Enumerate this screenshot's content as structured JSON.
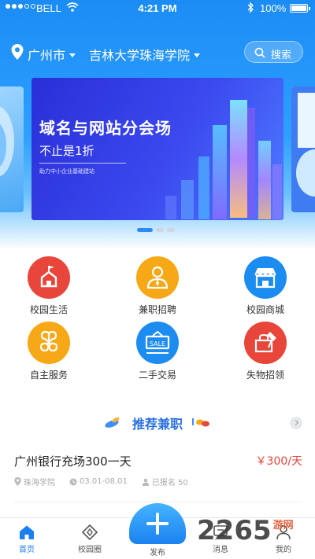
{
  "status_bar": {
    "carrier": "BELL",
    "time": "4:21 PM",
    "battery": "100%"
  },
  "header": {
    "city": "广州市",
    "school": "吉林大学珠海学院",
    "search_label": "搜索"
  },
  "banner": {
    "title": "域名与网站分会场",
    "subtitle": "不止是1折",
    "small_text": "助力中小企业基础建站",
    "page_count": 3,
    "active_page": 1
  },
  "services": [
    {
      "label": "校园生活",
      "icon": "flag-icon",
      "color": "#e8463a"
    },
    {
      "label": "兼职招聘",
      "icon": "recruiter-icon",
      "color": "#f6a817"
    },
    {
      "label": "校园商城",
      "icon": "shop-icon",
      "color": "#1c8cf0"
    },
    {
      "label": "自主服务",
      "icon": "clover-icon",
      "color": "#f6a817"
    },
    {
      "label": "二手交易",
      "icon": "trade-sign-icon",
      "color": "#1c8cf0"
    },
    {
      "label": "失物招领",
      "icon": "lost-found-icon",
      "color": "#e8463a"
    }
  ],
  "recommend": {
    "title": "推荐兼职",
    "jobs": [
      {
        "title": "广州银行充场300一天",
        "pay": "￥300/天",
        "location": "珠海学院",
        "dates": "03.01-08.01",
        "signed_up": "已报名 50"
      }
    ]
  },
  "tabs": {
    "home": "首页",
    "campus": "校园圈",
    "publish": "发布",
    "messages": "消息",
    "mine": "我的"
  },
  "watermark": {
    "text": "2265",
    "suffix": "游网"
  },
  "colors": {
    "primary": "#1b8cf5",
    "price": "#e2453b",
    "tab_active": "#1b7ff0"
  }
}
